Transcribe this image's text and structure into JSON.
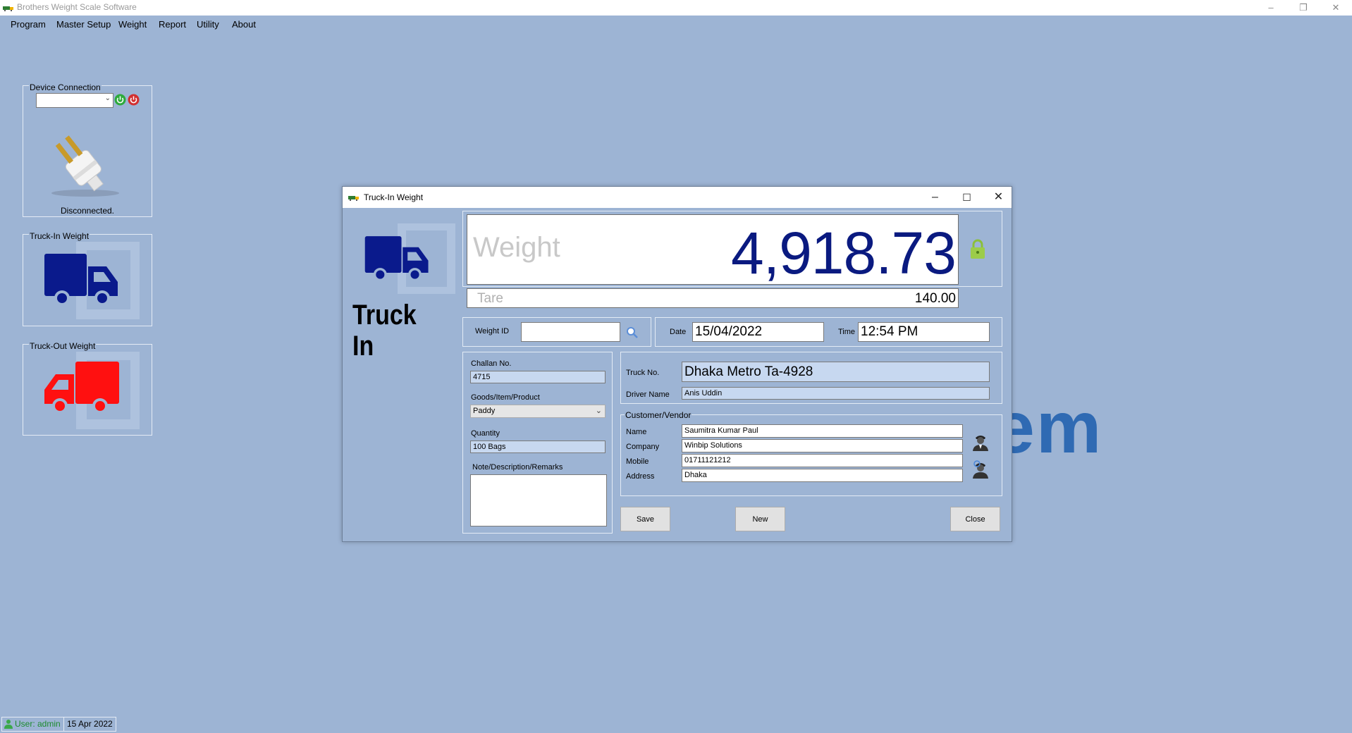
{
  "app": {
    "title": "Brothers Weight Scale Software"
  },
  "menu": [
    "Program",
    "Master Setup",
    "Weight",
    "Report",
    "Utility",
    "About"
  ],
  "left_panels": {
    "device": {
      "label": "Device Connection",
      "port_value": "",
      "status": "Disconnected."
    },
    "truck_in": {
      "label": "Truck-In Weight"
    },
    "truck_out": {
      "label": "Truck-Out Weight"
    }
  },
  "watermark": "em",
  "dialog": {
    "title": "Truck-In Weight",
    "heading_line1": "Truck",
    "heading_line2": "In",
    "weight_label": "Weight",
    "weight_value": "4,918.73",
    "tare_label": "Tare",
    "tare_value": "140.00",
    "weight_id_label": "Weight ID",
    "weight_id_value": "",
    "date_label": "Date",
    "date_value": "15/04/2022",
    "time_label": "Time",
    "time_value": "12:54 PM",
    "challan_label": "Challan No.",
    "challan_value": "4715",
    "goods_label": "Goods/Item/Product",
    "goods_value": "Paddy",
    "quantity_label": "Quantity",
    "quantity_value": "100 Bags",
    "note_label": "Note/Description/Remarks",
    "note_value": "",
    "truck_no_label": "Truck No.",
    "truck_no_value": "Dhaka Metro Ta-4928",
    "driver_label": "Driver Name",
    "driver_value": "Anis Uddin",
    "customer_group": "Customer/Vendor",
    "name_label": "Name",
    "name_value": "Saumitra Kumar Paul",
    "company_label": "Company",
    "company_value": "Winbip Solutions",
    "mobile_label": "Mobile",
    "mobile_value": "01711121212",
    "address_label": "Address",
    "address_value": "Dhaka",
    "save_label": "Save",
    "new_label": "New",
    "close_label": "Close"
  },
  "statusbar": {
    "user": "User: admin",
    "date": "15 Apr 2022"
  },
  "colors": {
    "background": "#9db4d4",
    "truck_in": "#0a1a8c",
    "truck_out": "#ff1010",
    "weight_text": "#0a1a80",
    "watermark": "#2f6ab3"
  }
}
